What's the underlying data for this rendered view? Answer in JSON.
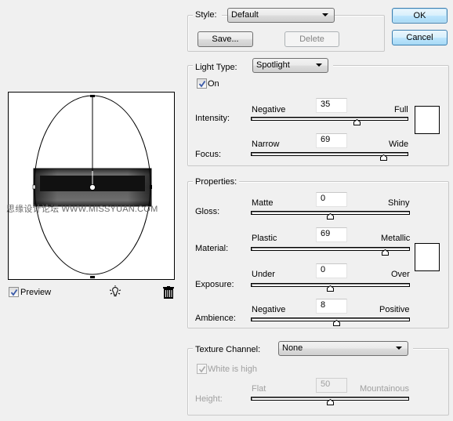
{
  "style": {
    "label": "Style:",
    "value": "Default",
    "save_label": "Save...",
    "delete_label": "Delete"
  },
  "buttons": {
    "ok": "OK",
    "cancel": "Cancel"
  },
  "light": {
    "type_label": "Light Type:",
    "type_value": "Spotlight",
    "on_label": "On",
    "on_checked": true,
    "intensity": {
      "label": "Intensity:",
      "min_label": "Negative",
      "max_label": "Full",
      "value": "35",
      "position": 0.675
    },
    "focus": {
      "label": "Focus:",
      "min_label": "Narrow",
      "max_label": "Wide",
      "value": "69",
      "position": 0.845
    },
    "color": "#ffffff"
  },
  "properties": {
    "title": "Properties:",
    "gloss": {
      "label": "Gloss:",
      "min_label": "Matte",
      "max_label": "Shiny",
      "value": "0",
      "position": 0.5
    },
    "material": {
      "label": "Material:",
      "min_label": "Plastic",
      "max_label": "Metallic",
      "value": "69",
      "position": 0.845
    },
    "exposure": {
      "label": "Exposure:",
      "min_label": "Under",
      "max_label": "Over",
      "value": "0",
      "position": 0.5
    },
    "ambience": {
      "label": "Ambience:",
      "min_label": "Negative",
      "max_label": "Positive",
      "value": "8",
      "position": 0.54
    },
    "color": "#ffffff"
  },
  "texture": {
    "label": "Texture Channel:",
    "value": "None",
    "white_is_high_label": "White is high",
    "white_is_high_checked": true,
    "height": {
      "label": "Height:",
      "min_label": "Flat",
      "max_label": "Mountainous",
      "value": "50",
      "position": 0.5
    }
  },
  "preview": {
    "label": "Preview",
    "checked": true,
    "watermark": "思缘设计论坛  WWW.MISSYUAN.COM",
    "icons": [
      "light-bulb-icon",
      "trash-icon"
    ]
  }
}
